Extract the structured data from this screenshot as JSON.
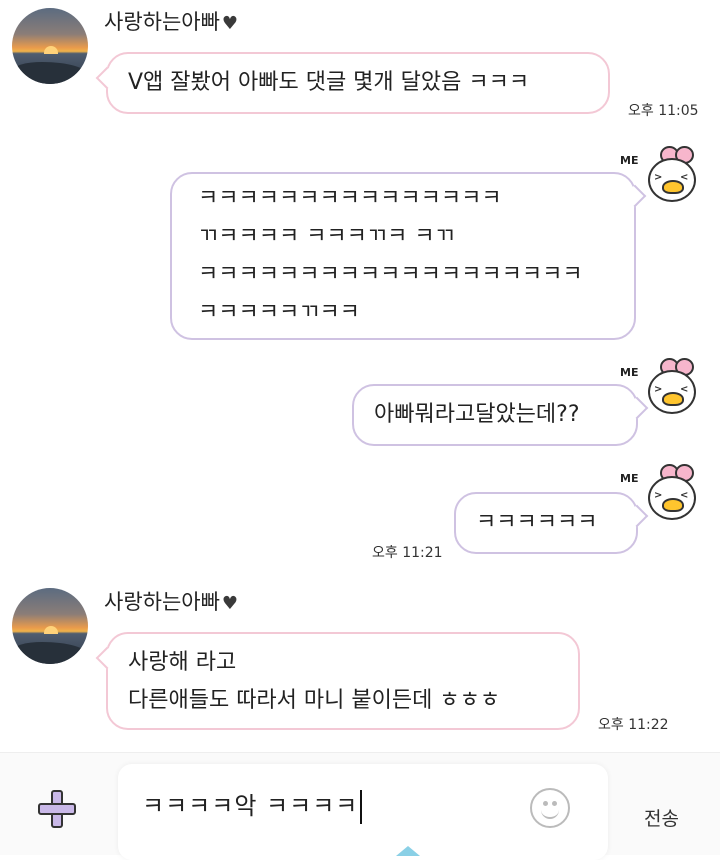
{
  "messages": [
    {
      "type": "received",
      "sender": "사랑하는아빠",
      "lines": [
        "V앱 잘봤어 아빠도 댓글 몇개 달았음 ㅋㅋㅋ"
      ],
      "time": "오후 11:05"
    },
    {
      "type": "sent",
      "badge": "ME",
      "lines": [
        "ㅋㅋㅋㅋㅋㅋㅋㅋㅋㅋㅋㅋㅋㅋㅋ",
        "ㄲㅋㅋㅋㅋ ㅋㅋㅋㄲㅋ ㅋㄲ",
        "ㅋㅋㅋㅋㅋㅋㅋㅋㅋㅋㅋㅋㅋㅋㅋㅋㅋㅋㅋ",
        "ㅋㅋㅋㅋㅋㄲㅋㅋ"
      ]
    },
    {
      "type": "sent",
      "badge": "ME",
      "lines": [
        "아빠뭐라고달았는데??"
      ]
    },
    {
      "type": "sent",
      "badge": "ME",
      "lines": [
        "ㅋㅋㅋㅋㅋㅋ"
      ],
      "time": "오후 11:21"
    },
    {
      "type": "received",
      "sender": "사랑하는아빠",
      "lines": [
        "사랑해 라고",
        "다른애들도 따라서 마니 붙이든데 ㅎㅎㅎ"
      ],
      "time": "오후 11:22"
    }
  ],
  "input": {
    "value": "ㅋㅋㅋㅋ악 ㅋㅋㅋㅋ",
    "send_label": "전송"
  },
  "icons": {
    "attach": "plus-icon",
    "emoji": "smiley-icon",
    "heart": "heart-icon",
    "sticker": "duck-me-sticker-icon"
  },
  "colors": {
    "received_border": "#f3c8d5",
    "sent_border": "#cfc2e2",
    "plus_fill": "#c9b8e8"
  }
}
